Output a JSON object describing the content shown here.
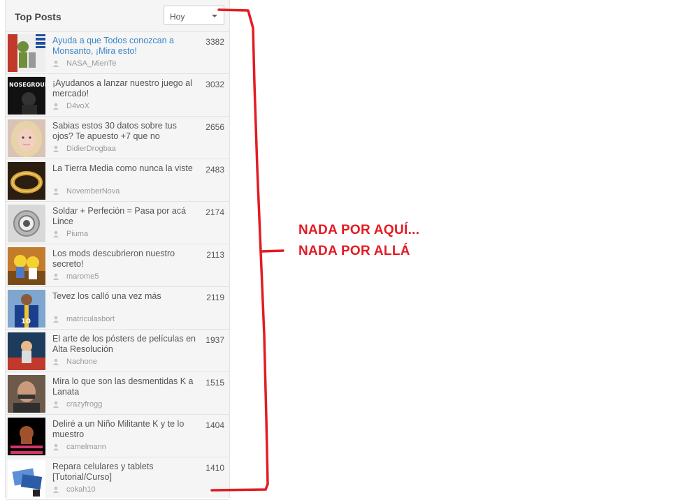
{
  "widget": {
    "title": "Top Posts",
    "period_select": {
      "selected": "Hoy"
    }
  },
  "posts": [
    {
      "title": "Ayuda a que Todos conozcan a Monsanto, ¡Mira esto!",
      "author": "NASA_MienTe",
      "score": "3382",
      "highlighted": true,
      "thumb_icon": "monsanto-thumb"
    },
    {
      "title": "¡Ayudanos a lanzar nuestro juego al mercado!",
      "author": "D4voX",
      "score": "3032",
      "thumb_icon": "noseground-thumb"
    },
    {
      "title": "Sabias estos 30 datos sobre tus ojos? Te apuesto +7 que no",
      "author": "DidierDrogbaa",
      "score": "2656",
      "thumb_icon": "woman-thumb"
    },
    {
      "title": "La Tierra Media como nunca la viste",
      "author": "NovemberNova",
      "score": "2483",
      "thumb_icon": "ring-thumb"
    },
    {
      "title": "Soldar + Perfeción = Pasa por acá Lince",
      "author": "Piuma",
      "score": "2174",
      "thumb_icon": "bearing-thumb"
    },
    {
      "title": "Los mods descubrieron nuestro secreto!",
      "author": "marome5",
      "score": "2113",
      "thumb_icon": "simpsons-thumb"
    },
    {
      "title": "Tevez los calló una vez más",
      "author": "matriculasbort",
      "score": "2119",
      "thumb_icon": "footballer-thumb"
    },
    {
      "title": "El arte de los pósters de películas en Alta Resolución",
      "author": "Nachone",
      "score": "1937",
      "thumb_icon": "poster-thumb"
    },
    {
      "title": "Mira lo que son las desmentidas K a Lanata",
      "author": "crazyfrogg",
      "score": "1515",
      "thumb_icon": "man-thumb"
    },
    {
      "title": "Deliré a un Niño Militante K y te lo muestro",
      "author": "camelmann",
      "score": "1404",
      "thumb_icon": "donkeykong-thumb"
    },
    {
      "title": "Repara celulares y tablets [Tutorial/Curso]",
      "author": "cokah10",
      "score": "1410",
      "thumb_icon": "tablets-thumb"
    }
  ],
  "annotation": {
    "line1": "NADA POR AQUÍ...",
    "line2": "NADA POR ALLÁ",
    "color": "#e31b23"
  },
  "colors": {
    "link_highlight": "#3b86c6",
    "text": "#555555",
    "muted": "#999999",
    "panel_bg": "#f5f5f5"
  }
}
